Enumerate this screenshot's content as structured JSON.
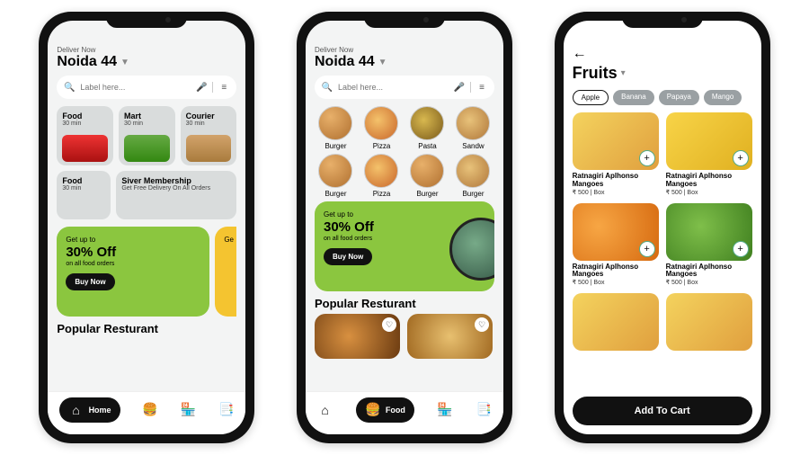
{
  "p1": {
    "deliver": "Deliver Now",
    "location": "Noida 44",
    "search_placeholder": "Label here...",
    "tiles": [
      {
        "title": "Food",
        "sub": "30 min"
      },
      {
        "title": "Mart",
        "sub": "30 min"
      },
      {
        "title": "Courier",
        "sub": "30 min"
      }
    ],
    "tiles2": {
      "title": "Food",
      "sub": "30 min"
    },
    "membership": {
      "title": "Siver Membership",
      "sub": "Get Free Delivery On All Orders"
    },
    "promo": {
      "l1": "Get up to",
      "l2": "30% Off",
      "l3": "on all food orders",
      "cta": "Buy Now"
    },
    "promo2_l1": "Ge",
    "section": "Popular Resturant",
    "nav_home": "Home"
  },
  "p2": {
    "deliver": "Deliver Now",
    "location": "Noida 44",
    "search_placeholder": "Label here...",
    "cats_row1": [
      "Burger",
      "Pizza",
      "Pasta",
      "Sandw"
    ],
    "cats_row2": [
      "Burger",
      "Pizza",
      "Burger",
      "Burger"
    ],
    "promo": {
      "l1": "Get up to",
      "l2": "30% Off",
      "l3": "on all food orders",
      "cta": "Buy Now"
    },
    "section": "Popular Resturant",
    "nav_food": "Food"
  },
  "p3": {
    "title": "Fruits",
    "chips": [
      "Apple",
      "Banana",
      "Papaya",
      "Mango"
    ],
    "products": [
      {
        "name": "Ratnagiri Aplhonso Mangoes",
        "price": "₹ 500 | Box"
      },
      {
        "name": "Ratnagiri Aplhonso Mangoes",
        "price": "₹ 500 | Box"
      },
      {
        "name": "Ratnagiri Aplhonso Mangoes",
        "price": "₹ 500 | Box"
      },
      {
        "name": "Ratnagiri Aplhonso Mangoes",
        "price": "₹ 500 | Box"
      }
    ],
    "cta": "Add To Cart"
  }
}
